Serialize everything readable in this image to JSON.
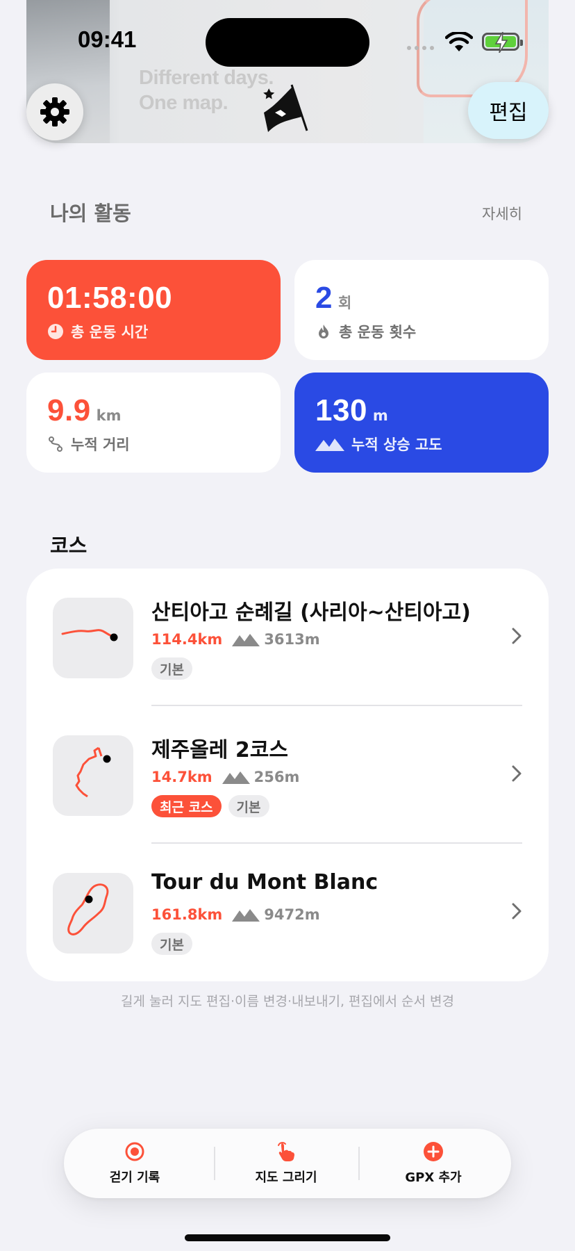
{
  "status_bar": {
    "time": "09:41"
  },
  "header": {
    "tagline_line1": "Different days.",
    "tagline_line2": "One map.",
    "settings_icon": "gear-icon",
    "logo_icon": "flag-logo-icon",
    "edit_label": "편집"
  },
  "activity": {
    "title": "나의 활동",
    "detail_label": "자세히",
    "cards": [
      {
        "value": "01:58:00",
        "unit": "",
        "label": "총 운동 시간",
        "icon": "clock-icon",
        "color": "#FC5139"
      },
      {
        "value": "2",
        "unit": "회",
        "label": "총 운동 횟수",
        "icon": "flame-icon",
        "color": "#FFFFFF"
      },
      {
        "value": "9.9",
        "unit": "km",
        "label": "누적 거리",
        "icon": "route-icon",
        "color": "#FFFFFF"
      },
      {
        "value": "130",
        "unit": "m",
        "label": "누적 상승 고도",
        "icon": "mountains-icon",
        "color": "#2A4AE4"
      }
    ]
  },
  "courses": {
    "title": "코스",
    "items": [
      {
        "name": "산티아고 순례길 (사리아~산티아고)",
        "distance": "114.4km",
        "ascent": "3613m",
        "tags": [
          "기본"
        ]
      },
      {
        "name": "제주올레 2코스",
        "distance": "14.7km",
        "ascent": "256m",
        "tags": [
          "최근 코스",
          "기본"
        ]
      },
      {
        "name": "Tour du Mont Blanc",
        "distance": "161.8km",
        "ascent": "9472m",
        "tags": [
          "기본"
        ]
      }
    ],
    "hint": "길게 눌러 지도 편집·이름 변경·내보내기, 편집에서 순서 변경"
  },
  "bottom_bar": {
    "items": [
      {
        "label": "걷기 기록",
        "icon": "record-icon"
      },
      {
        "label": "지도 그리기",
        "icon": "hand-draw-icon"
      },
      {
        "label": "GPX 추가",
        "icon": "plus-circle-icon"
      }
    ]
  },
  "colors": {
    "accent": "#FC5139",
    "blue": "#2A4AE4",
    "background": "#F2F2F7"
  }
}
